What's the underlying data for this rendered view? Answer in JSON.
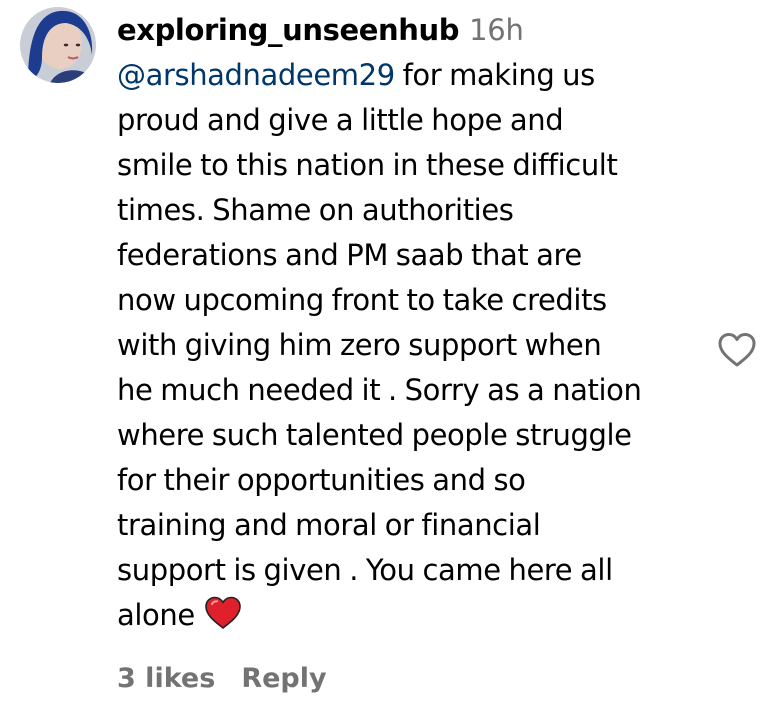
{
  "comment": {
    "username": "exploring_unseenhub",
    "timestamp": "16h",
    "mention": "@arshadnadeem29",
    "lines": [
      " for making us",
      "proud and give a little hope and",
      "smile to this nation in these difficult",
      "times. Shame on authorities",
      "federations and PM saab that are",
      "now upcoming front to take credits",
      "with giving him zero support when",
      "he much needed it . Sorry as a nation",
      "where such talented people struggle",
      "for their opportunities and so",
      "training and moral or financial",
      "support is given . You came here all",
      "alone"
    ],
    "emoji": "red-heart-emoji",
    "likes": "3 likes",
    "reply_label": "Reply"
  },
  "icons": {
    "like": "heart-outline-icon"
  },
  "colors": {
    "mention": "#00376b",
    "muted": "#737373",
    "heart": "#e0202c"
  }
}
